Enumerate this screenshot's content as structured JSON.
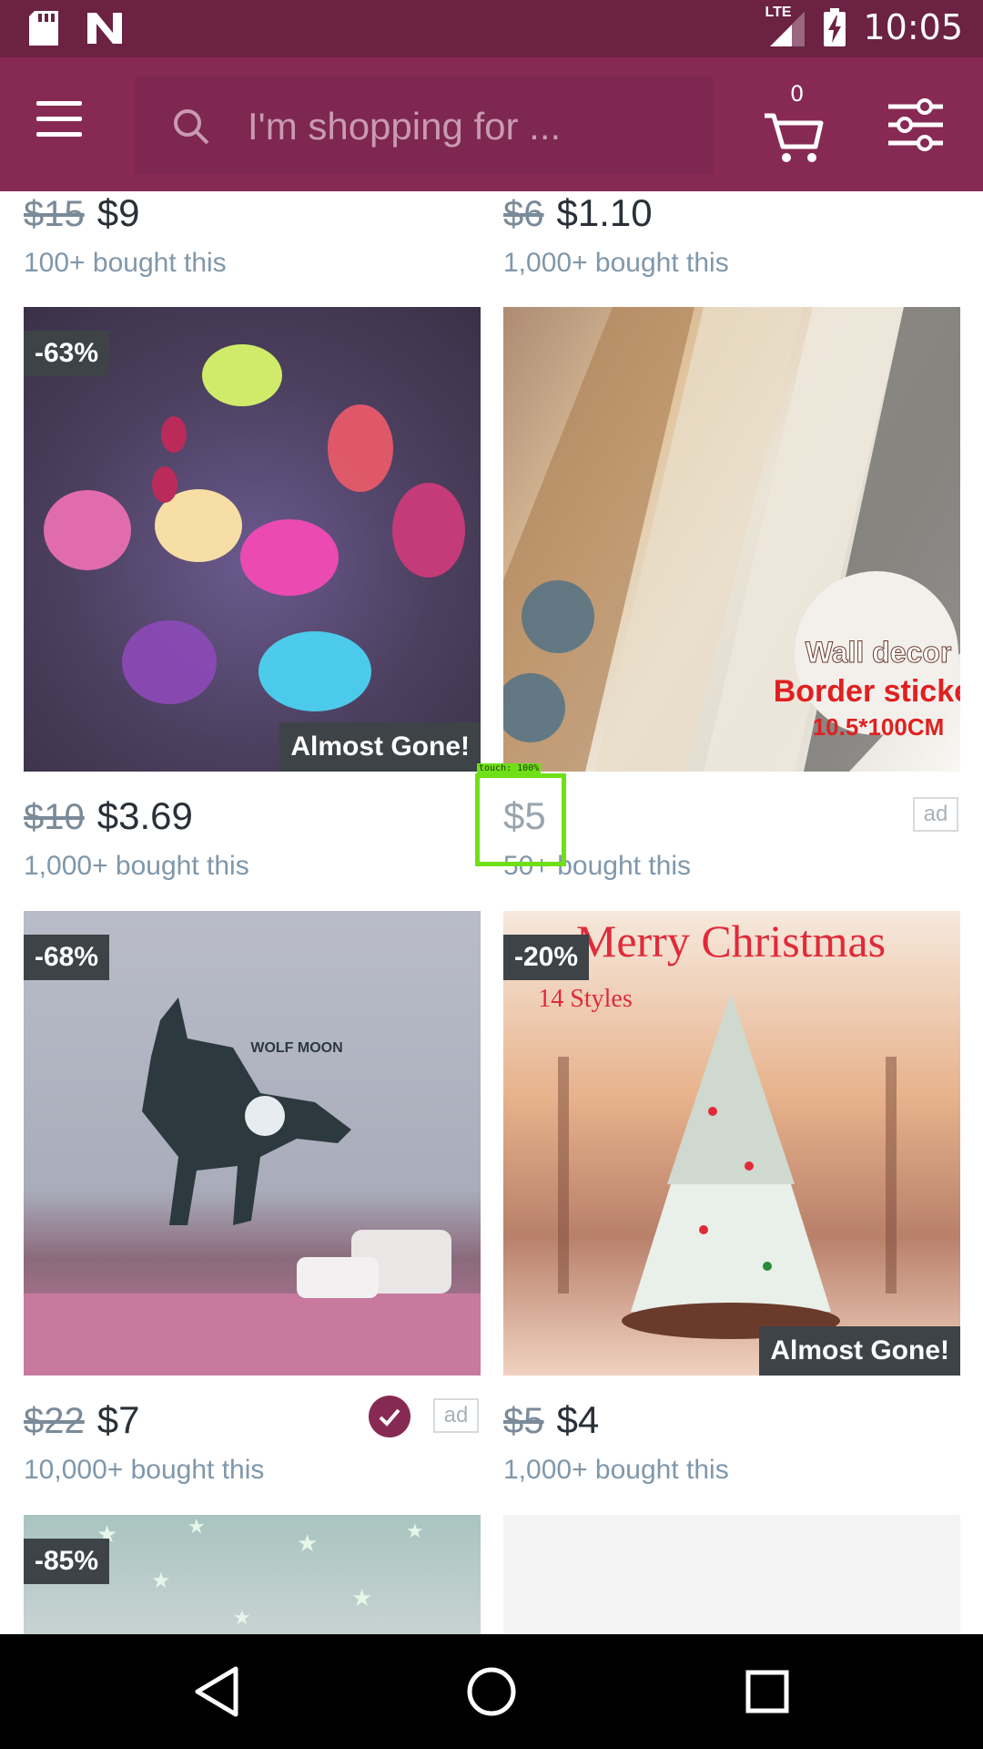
{
  "status_bar": {
    "time": "10:05",
    "network": "LTE"
  },
  "search": {
    "placeholder": "I'm shopping for ..."
  },
  "cart": {
    "count": "0"
  },
  "products": [
    {
      "old_price": "$15",
      "price": "$9",
      "bought": "100+ bought this"
    },
    {
      "old_price": "$6",
      "price": "$1.10",
      "bought": "1,000+ bought this"
    },
    {
      "discount": "-63%",
      "badge": "Almost Gone!",
      "old_price": "$10",
      "price": "$3.69",
      "bought": "1,000+ bought this"
    },
    {
      "image_text": [
        "Wall decor",
        "Border sticker",
        "10.5*100CM"
      ],
      "price": "$5",
      "bought": "50+ bought this",
      "ad": "ad"
    },
    {
      "discount": "-68%",
      "image_text": "WOLF MOON",
      "old_price": "$22",
      "price": "$7",
      "bought": "10,000+ bought this",
      "ad": "ad"
    },
    {
      "discount": "-20%",
      "image_text": [
        "Merry Christmas",
        "14 Styles"
      ],
      "badge": "Almost Gone!",
      "old_price": "$5",
      "price": "$4",
      "bought": "1,000+ bought this"
    },
    {
      "discount": "-85%"
    }
  ],
  "touch_indicator": "touch: 100%",
  "colors": {
    "brand": "#872a53",
    "status_bar": "#6b2243",
    "badge_bg": "#3d4347",
    "touch": "#6fe017"
  }
}
